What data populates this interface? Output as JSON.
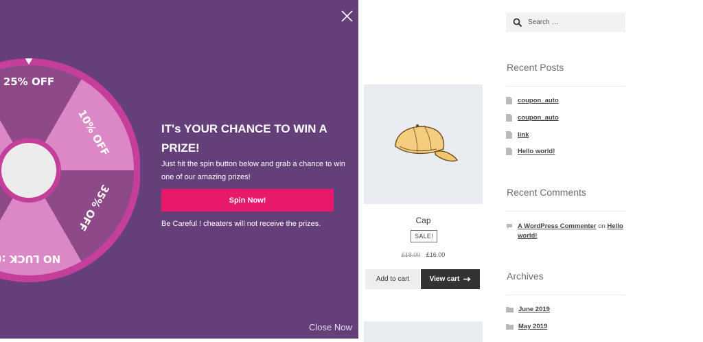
{
  "popup": {
    "heading": "IT's YOUR CHANCE TO WIN A PRIZE!",
    "description": "Just hit the spin button below and grab a chance to win one of our amazing prizes!",
    "spin_label": "Spin Now!",
    "warning": "Be Careful ! cheaters will not receive the prizes.",
    "close_now": "Close Now",
    "close_icon": "close-icon",
    "colors": {
      "background": "#653f7a",
      "wheel_rim": "#c63e9b",
      "segment_light": "#dc88c7",
      "segment_dark": "#8e4a88",
      "button": "#e8196b"
    },
    "wheel": {
      "segments": [
        "25% OFF",
        "10% OFF",
        "35% OFF",
        "NO LUCK :("
      ]
    }
  },
  "product": {
    "title": "Cap",
    "badge": "SALE!",
    "price_old": "£18.00",
    "price_new": "£16.00",
    "add_to_cart": "Add to cart",
    "view_cart": "View cart"
  },
  "sidebar": {
    "search_placeholder": "Search …",
    "recent_posts_title": "Recent Posts",
    "recent_posts": [
      "coupon_auto",
      "coupon_auto",
      "link",
      "Hello world!"
    ],
    "recent_comments_title": "Recent Comments",
    "comment": {
      "author": "A WordPress Commenter",
      "on": "on",
      "post": "Hello world!"
    },
    "archives_title": "Archives",
    "archives": [
      "June 2019",
      "May 2019"
    ]
  }
}
